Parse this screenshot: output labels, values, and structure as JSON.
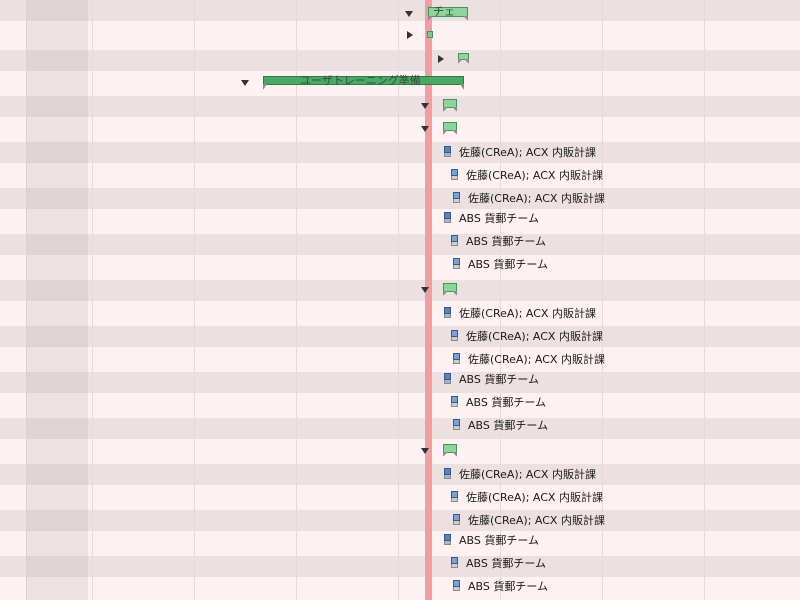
{
  "colors": {
    "background": "#fdf1f1",
    "row_alt": "#ece0e0",
    "today_line": "#ef9ea4",
    "summary_bar": "#4aa865",
    "task_bar": "#8fd39d"
  },
  "gantt": {
    "top_task_label": "チェ",
    "summary_task_label": "ユーザトレーニング準備",
    "resources": {
      "sato": "佐藤(CReA); ACX 内販計課",
      "abs": "ABS 貨郵チーム"
    }
  },
  "icons": {
    "expand_down": "triangle-down",
    "expand_right": "triangle-right",
    "resource": "person-icon",
    "resource_group": "group-icon"
  }
}
